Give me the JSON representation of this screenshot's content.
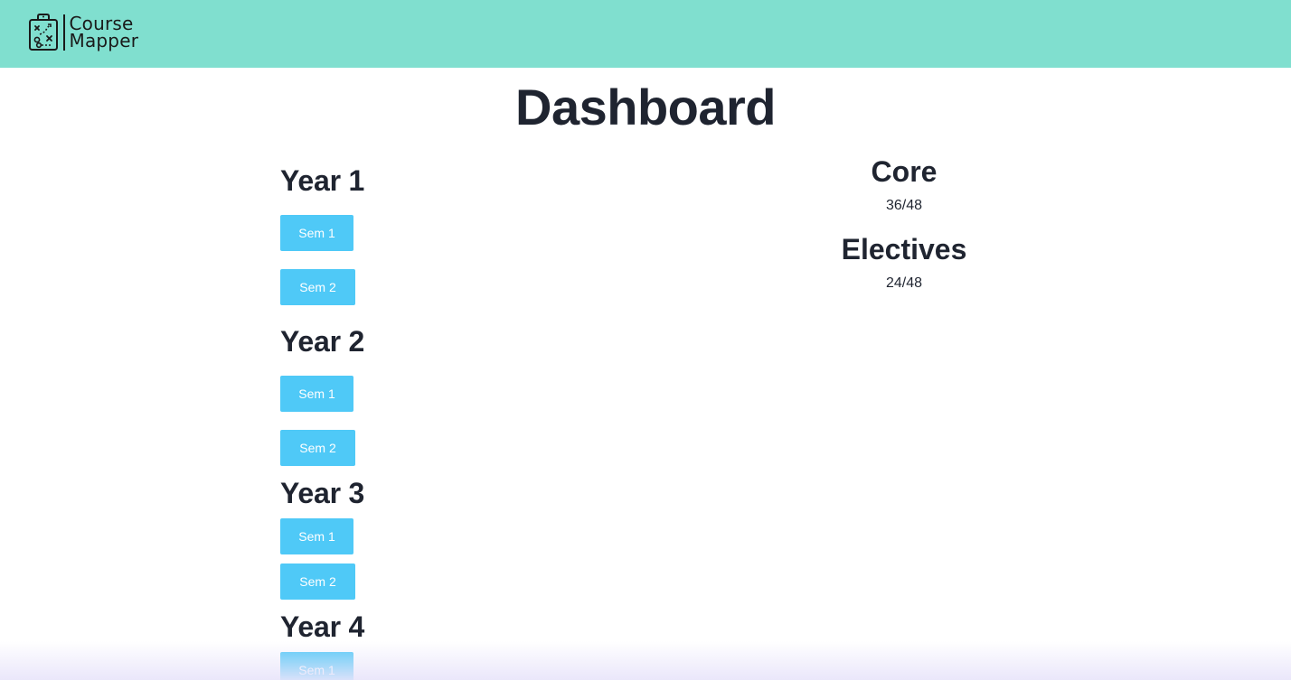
{
  "brand": {
    "line1": "Course",
    "line2": "Mapper",
    "icon": "clipboard-map-icon"
  },
  "colors": {
    "header_bg": "#80dfcf",
    "button_bg": "#4fc9f7",
    "text": "#1f2430"
  },
  "page": {
    "title": "Dashboard"
  },
  "years": [
    {
      "label": "Year 1",
      "sem1": "Sem 1",
      "sem2": "Sem 2"
    },
    {
      "label": "Year 2",
      "sem1": "Sem 1",
      "sem2": "Sem 2"
    },
    {
      "label": "Year 3",
      "sem1": "Sem 1",
      "sem2": "Sem 2"
    },
    {
      "label": "Year 4",
      "sem1": "Sem 1"
    }
  ],
  "progress": {
    "core": {
      "label": "Core",
      "value": "36/48"
    },
    "electives": {
      "label": "Electives",
      "value": "24/48"
    }
  }
}
